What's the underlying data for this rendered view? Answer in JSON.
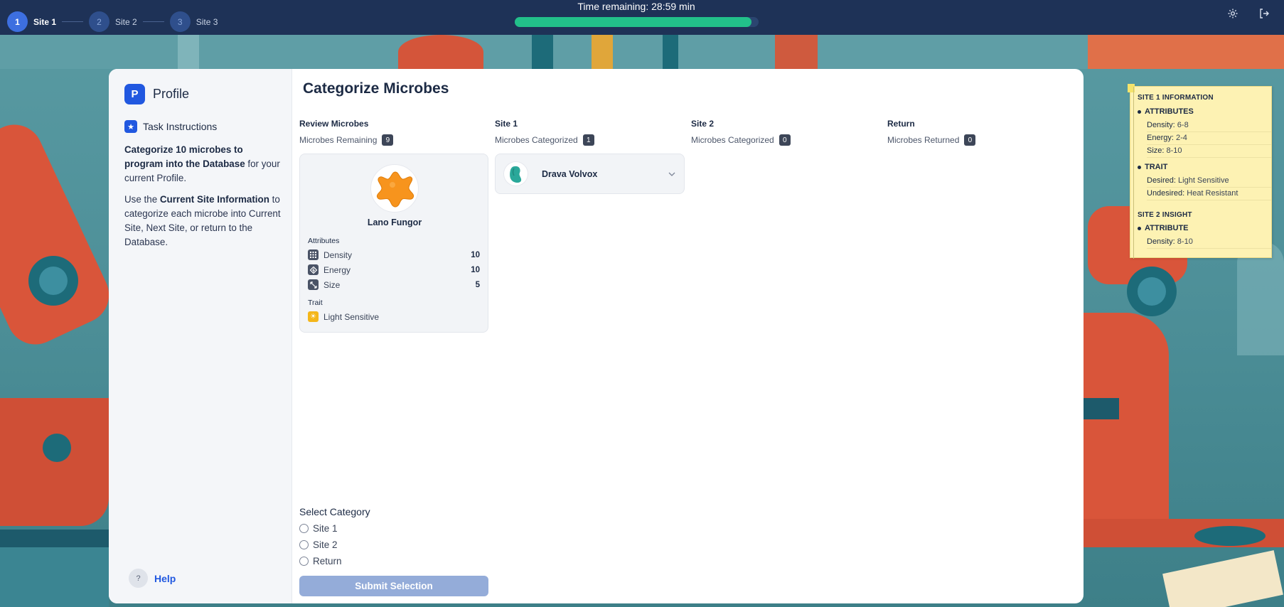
{
  "stepper": {
    "steps": [
      {
        "number": "1",
        "label": "Site 1"
      },
      {
        "number": "2",
        "label": "Site 2"
      },
      {
        "number": "3",
        "label": "Site 3"
      }
    ],
    "active_step": 1
  },
  "timer": {
    "text": "Time remaining: 28:59 min",
    "progress_fraction": 0.97
  },
  "toolbar": {
    "settings_icon": "gear-icon",
    "logout_icon": "logout-icon"
  },
  "sidebar": {
    "profile_badge": "P",
    "profile_title": "Profile",
    "instructions_title": "Task Instructions",
    "instructions_p1_bold": "Categorize 10 microbes to program into the Database",
    "instructions_p1_rest": " for your current Profile.",
    "instructions_p2_start": "Use the ",
    "instructions_p2_bold": "Current Site Information",
    "instructions_p2_rest": " to categorize each microbe into Current Site, Next Site, or return to the Database.",
    "help_badge": "?",
    "help_label": "Help"
  },
  "main": {
    "title": "Categorize Microbes",
    "columns": [
      {
        "title": "Review Microbes",
        "sub": "Microbes Remaining",
        "count": "9"
      },
      {
        "title": "Site 1",
        "sub": "Microbes Categorized",
        "count": "1"
      },
      {
        "title": "Site 2",
        "sub": "Microbes Categorized",
        "count": "0"
      },
      {
        "title": "Return",
        "sub": "Microbes Returned",
        "count": "0"
      }
    ],
    "current_microbe": {
      "name": "Lano Fungor",
      "color": "#f7941d",
      "attributes_label": "Attributes",
      "attributes": [
        {
          "name": "Density",
          "value": "10",
          "icon": "grid-icon"
        },
        {
          "name": "Energy",
          "value": "10",
          "icon": "energy-icon"
        },
        {
          "name": "Size",
          "value": "5",
          "icon": "size-icon"
        }
      ],
      "trait_label": "Trait",
      "trait": "Light Sensitive",
      "trait_icon": "sun-icon"
    },
    "site1_items": [
      {
        "name": "Drava Volvox",
        "color": "#2aa89a"
      }
    ],
    "select": {
      "title": "Select Category",
      "options": [
        "Site 1",
        "Site 2",
        "Return"
      ],
      "submit_label": "Submit Selection"
    }
  },
  "note": {
    "heading": "SITE 1 INFORMATION",
    "attributes_title": "ATTRIBUTES",
    "attributes": [
      {
        "k": "Density:",
        "v": " 6-8"
      },
      {
        "k": "Energy:",
        "v": " 2-4"
      },
      {
        "k": "Size:",
        "v": " 8-10"
      }
    ],
    "trait_title": "TRAIT",
    "traits": [
      {
        "k": "Desired:",
        "v": " Light Sensitive"
      },
      {
        "k": "Undesired:",
        "v": " Heat Resistant"
      }
    ],
    "insight_heading": "SITE 2 INSIGHT",
    "insight_title": "ATTRIBUTE",
    "insight": [
      {
        "k": "Density:",
        "v": " 8-10"
      }
    ]
  },
  "colors": {
    "topbar": "#1e3257",
    "accent": "#2158e0",
    "progress": "#22c08a",
    "submit_disabled": "#94acd9"
  }
}
